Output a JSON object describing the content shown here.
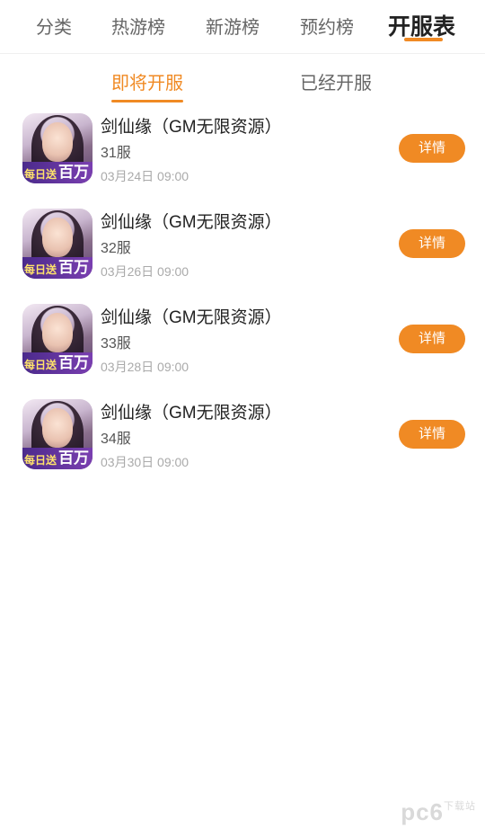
{
  "top_tabs": [
    "分类",
    "热游榜",
    "新游榜",
    "预约榜",
    "开服表"
  ],
  "sub_tabs": [
    "即将开服",
    "已经开服"
  ],
  "accent_color": "#f08a24",
  "items": [
    {
      "title": "剑仙缘（GM无限资源）",
      "server": "31服",
      "time": "03月24日 09:00",
      "button": "详情",
      "icon_text_1": "每日送",
      "icon_text_2": "百万"
    },
    {
      "title": "剑仙缘（GM无限资源）",
      "server": "32服",
      "time": "03月26日 09:00",
      "button": "详情",
      "icon_text_1": "每日送",
      "icon_text_2": "百万"
    },
    {
      "title": "剑仙缘（GM无限资源）",
      "server": "33服",
      "time": "03月28日 09:00",
      "button": "详情",
      "icon_text_1": "每日送",
      "icon_text_2": "百万"
    },
    {
      "title": "剑仙缘（GM无限资源）",
      "server": "34服",
      "time": "03月30日 09:00",
      "button": "详情",
      "icon_text_1": "每日送",
      "icon_text_2": "百万"
    }
  ],
  "watermark": {
    "main": "pc6",
    "sub": "下载站"
  }
}
